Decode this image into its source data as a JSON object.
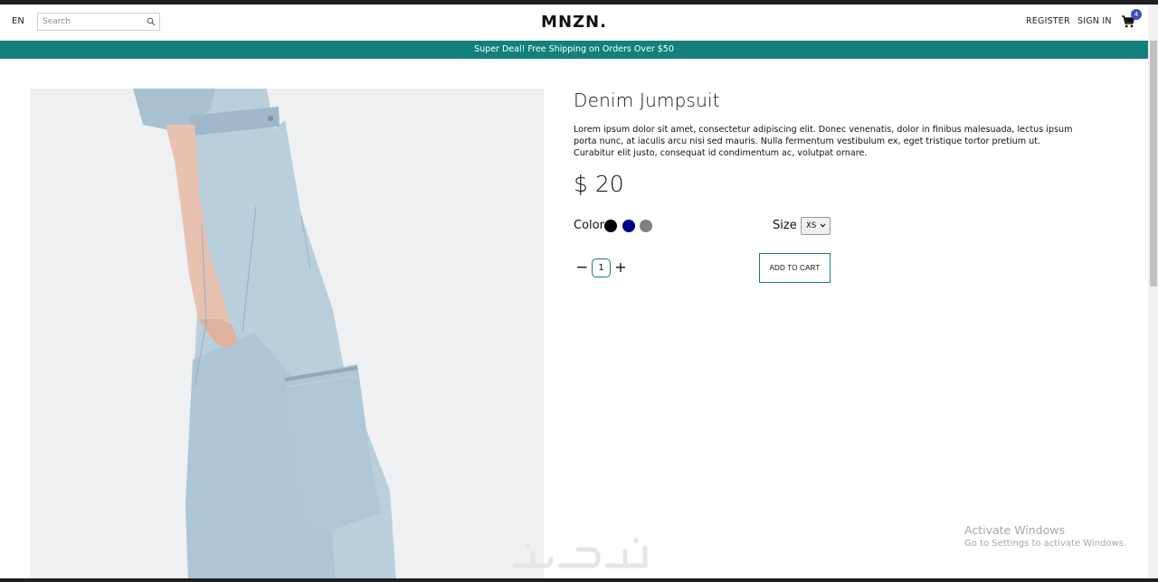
{
  "header": {
    "language": "EN",
    "search_placeholder": "Search",
    "logo": "MNZN.",
    "register": "REGISTER",
    "sign_in": "SIGN IN",
    "cart_count": "4"
  },
  "banner": {
    "text": "Super Deal! Free Shipping on Orders Over $50"
  },
  "product": {
    "title": "Denim Jumpsuit",
    "description": "Lorem ipsum dolor sit amet, consectetur adipiscing elit. Donec venenatis, dolor in finibus malesuada, lectus ipsum porta nunc, at iaculis arcu nisi sed mauris. Nulla fermentum vestibulum ex, eget tristique tortor pretium ut. Curabitur elit justo, consequat id condimentum ac, volutpat ornare.",
    "price": "$ 20",
    "color_label": "Color",
    "colors": [
      "#000000",
      "#00008b",
      "#808080"
    ],
    "size_label": "Size",
    "size_selected": "XS",
    "quantity": "1",
    "add_to_cart": "ADD TO CART"
  },
  "watermark": {
    "title": "Activate Windows",
    "subtitle": "Go to Settings to activate Windows."
  },
  "theme": {
    "accent": "#13807b",
    "badge": "#3f51b5"
  }
}
